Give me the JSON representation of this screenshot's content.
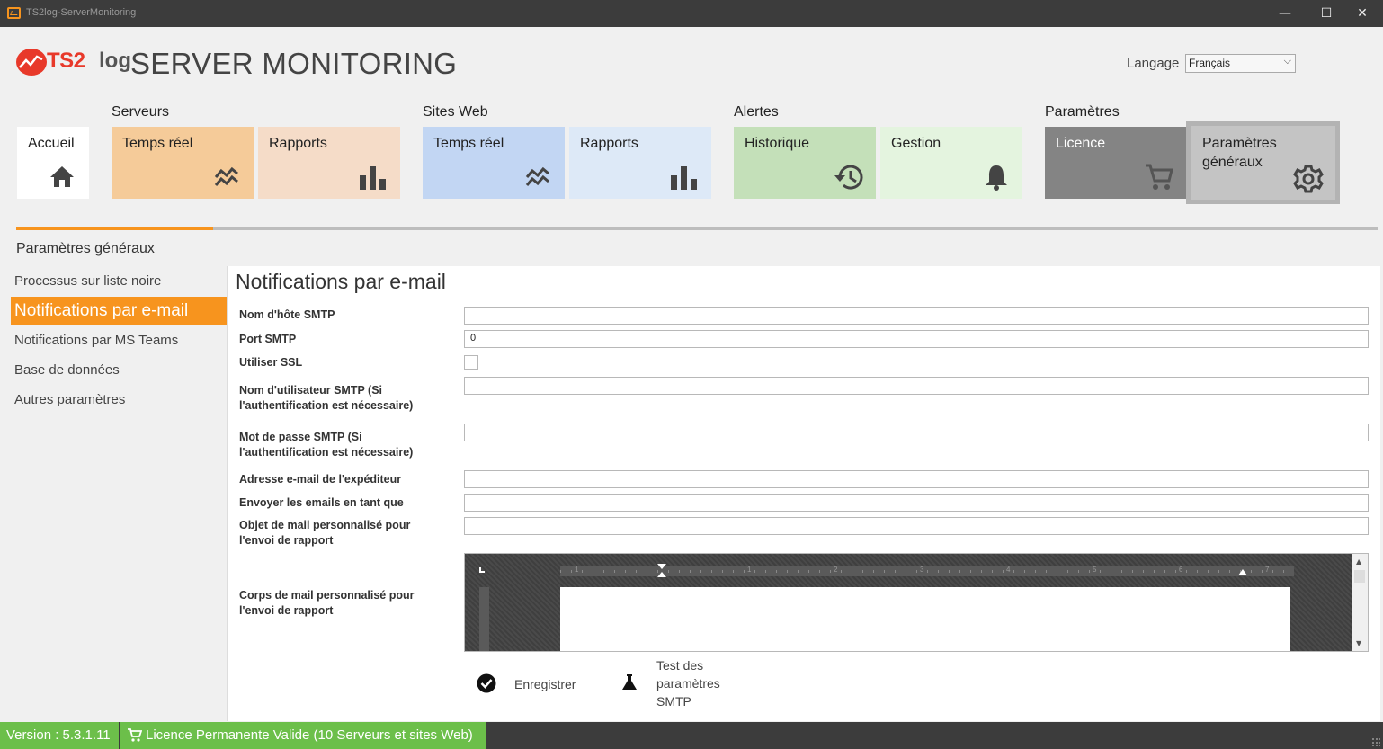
{
  "window": {
    "title": "TS2log-ServerMonitoring",
    "minimize": "—",
    "maximize": "☐",
    "close": "✕"
  },
  "header": {
    "logo_ts2": "TS2",
    "logo_log": "log",
    "app_title": "SERVER MONITORING",
    "language_label": "Langage",
    "language_value": "Français"
  },
  "groups": {
    "servers": "Serveurs",
    "websites": "Sites Web",
    "alerts": "Alertes",
    "settings": "Paramètres"
  },
  "tiles": {
    "home": "Accueil",
    "servers_realtime": "Temps réel",
    "servers_reports": "Rapports",
    "web_realtime": "Temps réel",
    "web_reports": "Rapports",
    "alerts_history": "Historique",
    "alerts_management": "Gestion",
    "settings_license": "Licence",
    "settings_general_line1": "Paramètres",
    "settings_general_line2": "généraux"
  },
  "section_title": "Paramètres généraux",
  "nav": {
    "items": [
      "Processus sur liste noire",
      "Notifications par e-mail",
      "Notifications par MS Teams",
      "Base de données",
      "Autres paramètres"
    ],
    "active_index": 1
  },
  "form": {
    "title": "Notifications par e-mail",
    "smtp_host_label": "Nom d'hôte SMTP",
    "smtp_host_value": "",
    "smtp_port_label": "Port SMTP",
    "smtp_port_value": "0",
    "use_ssl_label": "Utiliser SSL",
    "use_ssl_checked": false,
    "smtp_user_label_1": "Nom d'utilisateur SMTP (Si",
    "smtp_user_label_2": "l'authentification est nécessaire)",
    "smtp_user_value": "",
    "smtp_pass_label_1": "Mot de passe SMTP (Si",
    "smtp_pass_label_2": "l'authentification est nécessaire)",
    "smtp_pass_value": "",
    "sender_label": "Adresse e-mail de l'expéditeur",
    "sender_value": "",
    "send_as_label": "Envoyer les emails en tant que",
    "send_as_value": "",
    "subject_label_1": "Objet de mail personnalisé pour",
    "subject_label_2": "l'envoi de rapport",
    "subject_value": "",
    "body_label_1": "Corps de mail personnalisé pour",
    "body_label_2": "l'envoi de rapport",
    "ruler_numbers": [
      "1",
      "1",
      "2",
      "3",
      "4",
      "5",
      "6",
      "7"
    ],
    "save_label": "Enregistrer",
    "test_label_1": "Test des",
    "test_label_2": "paramètres",
    "test_label_3": "SMTP"
  },
  "status": {
    "version": "Version : 5.3.1.11",
    "license": "Licence Permanente Valide (10 Serveurs et sites Web)"
  },
  "colors": {
    "accent": "#f7941e",
    "status_green": "#6cbf4a",
    "logo_red": "#e8392a"
  }
}
